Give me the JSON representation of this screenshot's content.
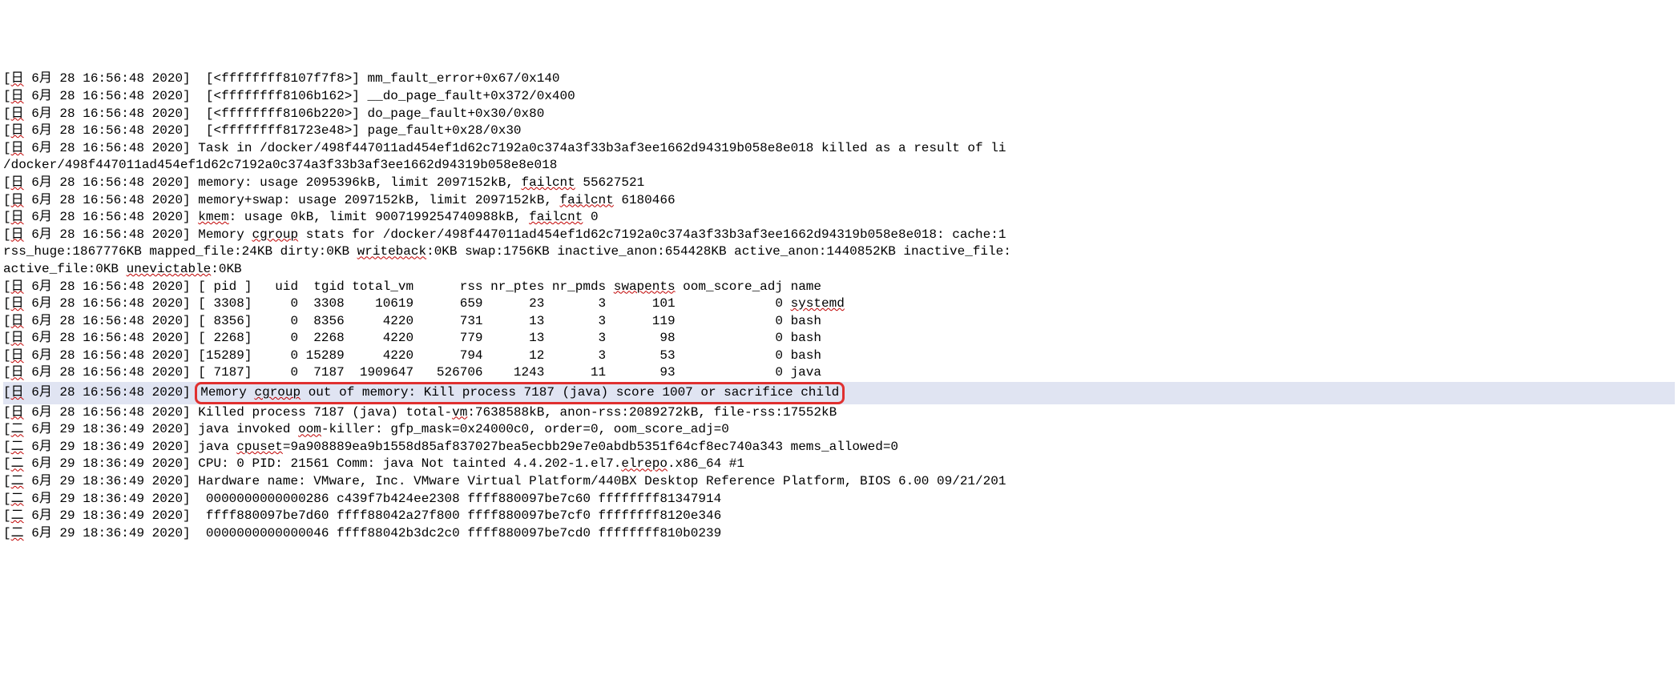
{
  "timestamp_prefix": {
    "day1": "日",
    "month1": "6月",
    "date1": "28",
    "time1": "16:56:48",
    "year1": "2020",
    "day2": "二",
    "date2": "29",
    "time2": "18:36:49"
  },
  "lines": [
    "[日 6月 28 16:56:48 2020]  [<ffffffff8107f7f8>] mm_fault_error+0x67/0x140",
    "[日 6月 28 16:56:48 2020]  [<ffffffff8106b162>] __do_page_fault+0x372/0x400",
    "[日 6月 28 16:56:48 2020]  [<ffffffff8106b220>] do_page_fault+0x30/0x80",
    "[日 6月 28 16:56:48 2020]  [<ffffffff81723e48>] page_fault+0x28/0x30",
    "[日 6月 28 16:56:48 2020] Task in /docker/498f447011ad454ef1d62c7192a0c374a3f33b3af3ee1662d94319b058e8e018 killed as a result of li",
    "/docker/498f447011ad454ef1d62c7192a0c374a3f33b3af3ee1662d94319b058e8e018",
    "[日 6月 28 16:56:48 2020] memory: usage 2095396kB, limit 2097152kB, failcnt 55627521",
    "[日 6月 28 16:56:48 2020] memory+swap: usage 2097152kB, limit 2097152kB, failcnt 6180466",
    "[日 6月 28 16:56:48 2020] kmem: usage 0kB, limit 9007199254740988kB, failcnt 0",
    "[日 6月 28 16:56:48 2020] Memory cgroup stats for /docker/498f447011ad454ef1d62c7192a0c374a3f33b3af3ee1662d94319b058e8e018: cache:1",
    "rss_huge:1867776KB mapped_file:24KB dirty:0KB writeback:0KB swap:1756KB inactive_anon:654428KB active_anon:1440852KB inactive_file:",
    "active_file:0KB unevictable:0KB",
    "[日 6月 28 16:56:48 2020] [ pid ]   uid  tgid total_vm      rss nr_ptes nr_pmds swapents oom_score_adj name",
    "[日 6月 28 16:56:48 2020] [ 3308]     0  3308    10619      659      23       3      101             0 systemd",
    "[日 6月 28 16:56:48 2020] [ 8356]     0  8356     4220      731      13       3      119             0 bash",
    "[日 6月 28 16:56:48 2020] [ 2268]     0  2268     4220      779      13       3       98             0 bash",
    "[日 6月 28 16:56:48 2020] [15289]     0 15289     4220      794      12       3       53             0 bash",
    "[日 6月 28 16:56:48 2020] [ 7187]     0  7187  1909647   526706    1243      11       93             0 java",
    "[日 6月 28 16:56:48 2020] Memory cgroup out of memory: Kill process 7187 (java) score 1007 or sacrifice child",
    "[日 6月 28 16:56:48 2020] Killed process 7187 (java) total-vm:7638588kB, anon-rss:2089272kB, file-rss:17552kB",
    "[二 6月 29 18:36:49 2020] java invoked oom-killer: gfp_mask=0x24000c0, order=0, oom_score_adj=0",
    "[二 6月 29 18:36:49 2020] java cpuset=9a908889ea9b1558d85af837027bea5ecbb29e7e0abdb5351f64cf8ec740a343 mems_allowed=0",
    "[二 6月 29 18:36:49 2020] CPU: 0 PID: 21561 Comm: java Not tainted 4.4.202-1.el7.elrepo.x86_64 #1",
    "[二 6月 29 18:36:49 2020] Hardware name: VMware, Inc. VMware Virtual Platform/440BX Desktop Reference Platform, BIOS 6.00 09/21/201",
    "[二 6月 29 18:36:49 2020]  0000000000000286 c439f7b424ee2308 ffff880097be7c60 ffffffff81347914",
    "[二 6月 29 18:36:49 2020]  ffff880097be7d60 ffff88042a27f800 ffff880097be7cf0 ffffffff8120e346",
    "[二 6月 29 18:36:49 2020]  0000000000000046 ffff88042b3dc2c0 ffff880097be7cd0 ffffffff810b0239"
  ],
  "squiggle_words": [
    "日",
    "二",
    "failcnt",
    "kmem",
    "cgroup",
    "writeback",
    "swapents",
    "systemd",
    "oom",
    "cpuset",
    "elrepo",
    "unevictable",
    "vm"
  ],
  "highlighted_line_index": 18,
  "process_table": {
    "headers": [
      "pid",
      "uid",
      "tgid",
      "total_vm",
      "rss",
      "nr_ptes",
      "nr_pmds",
      "swapents",
      "oom_score_adj",
      "name"
    ],
    "rows": [
      {
        "pid": 3308,
        "uid": 0,
        "tgid": 3308,
        "total_vm": 10619,
        "rss": 659,
        "nr_ptes": 23,
        "nr_pmds": 3,
        "swapents": 101,
        "oom_score_adj": 0,
        "name": "systemd"
      },
      {
        "pid": 8356,
        "uid": 0,
        "tgid": 8356,
        "total_vm": 4220,
        "rss": 731,
        "nr_ptes": 13,
        "nr_pmds": 3,
        "swapents": 119,
        "oom_score_adj": 0,
        "name": "bash"
      },
      {
        "pid": 2268,
        "uid": 0,
        "tgid": 2268,
        "total_vm": 4220,
        "rss": 779,
        "nr_ptes": 13,
        "nr_pmds": 3,
        "swapents": 98,
        "oom_score_adj": 0,
        "name": "bash"
      },
      {
        "pid": 15289,
        "uid": 0,
        "tgid": 15289,
        "total_vm": 4220,
        "rss": 794,
        "nr_ptes": 12,
        "nr_pmds": 3,
        "swapents": 53,
        "oom_score_adj": 0,
        "name": "bash"
      },
      {
        "pid": 7187,
        "uid": 0,
        "tgid": 7187,
        "total_vm": 1909647,
        "rss": 526706,
        "nr_ptes": 1243,
        "nr_pmds": 11,
        "swapents": 93,
        "oom_score_adj": 0,
        "name": "java"
      }
    ]
  },
  "oom_kill": {
    "message": "Memory cgroup out of memory: Kill process 7187 (java) score 1007 or sacrifice child",
    "killed": "Killed process 7187 (java) total-vm:7638588kB, anon-rss:2089272kB, file-rss:17552kB"
  },
  "memory_stats": {
    "usage_kb": 2095396,
    "limit_kb": 2097152,
    "failcnt": 55627521,
    "swap_usage_kb": 2097152,
    "swap_limit_kb": 2097152,
    "swap_failcnt": 6180466,
    "kmem_usage_kb": 0,
    "kmem_limit_kb": "9007199254740988",
    "kmem_failcnt": 0
  }
}
